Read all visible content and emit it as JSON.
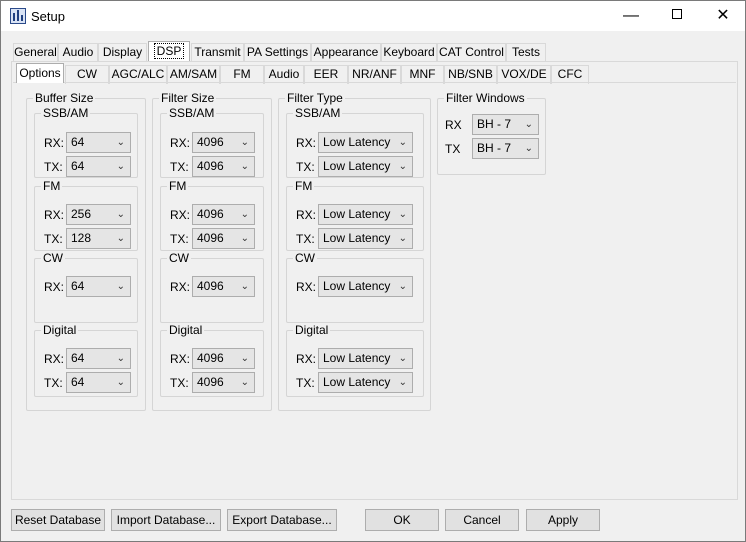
{
  "window": {
    "title": "Setup"
  },
  "top_tabs": [
    "General",
    "Audio",
    "Display",
    "DSP",
    "Transmit",
    "PA Settings",
    "Appearance",
    "Keyboard",
    "CAT Control",
    "Tests"
  ],
  "sub_tabs": [
    "Options",
    "CW",
    "AGC/ALC",
    "AM/SAM",
    "FM",
    "Audio",
    "EER",
    "NR/ANF",
    "MNF",
    "NB/SNB",
    "VOX/DE",
    "CFC"
  ],
  "groups": {
    "buffer_size": {
      "title": "Buffer Size",
      "ssb_am": {
        "title": "SSB/AM",
        "rx_label": "RX:",
        "rx": "64",
        "tx_label": "TX:",
        "tx": "64"
      },
      "fm": {
        "title": "FM",
        "rx_label": "RX:",
        "rx": "256",
        "tx_label": "TX:",
        "tx": "128"
      },
      "cw": {
        "title": "CW",
        "rx_label": "RX:",
        "rx": "64"
      },
      "digital": {
        "title": "Digital",
        "rx_label": "RX:",
        "rx": "64",
        "tx_label": "TX:",
        "tx": "64"
      }
    },
    "filter_size": {
      "title": "Filter Size",
      "ssb_am": {
        "title": "SSB/AM",
        "rx_label": "RX:",
        "rx": "4096",
        "tx_label": "TX:",
        "tx": "4096"
      },
      "fm": {
        "title": "FM",
        "rx_label": "RX:",
        "rx": "4096",
        "tx_label": "TX:",
        "tx": "4096"
      },
      "cw": {
        "title": "CW",
        "rx_label": "RX:",
        "rx": "4096"
      },
      "digital": {
        "title": "Digital",
        "rx_label": "RX:",
        "rx": "4096",
        "tx_label": "TX:",
        "tx": "4096"
      }
    },
    "filter_type": {
      "title": "Filter Type",
      "ssb_am": {
        "title": "SSB/AM",
        "rx_label": "RX:",
        "rx": "Low Latency",
        "tx_label": "TX:",
        "tx": "Low Latency"
      },
      "fm": {
        "title": "FM",
        "rx_label": "RX:",
        "rx": "Low Latency",
        "tx_label": "TX:",
        "tx": "Low Latency"
      },
      "cw": {
        "title": "CW",
        "rx_label": "RX:",
        "rx": "Low Latency"
      },
      "digital": {
        "title": "Digital",
        "rx_label": "RX:",
        "rx": "Low Latency",
        "tx_label": "TX:",
        "tx": "Low Latency"
      }
    },
    "filter_windows": {
      "title": "Filter Windows",
      "rx_label": "RX",
      "rx": "BH - 7",
      "tx_label": "TX",
      "tx": "BH - 7"
    }
  },
  "buttons": {
    "reset": "Reset Database",
    "import": "Import Database...",
    "export": "Export Database...",
    "ok": "OK",
    "cancel": "Cancel",
    "apply": "Apply"
  },
  "icons": {
    "app": "app-icon",
    "minimize": "minimize-icon",
    "maximize": "maximize-icon",
    "close": "close-icon",
    "dropdown": "chevron-down-icon"
  }
}
